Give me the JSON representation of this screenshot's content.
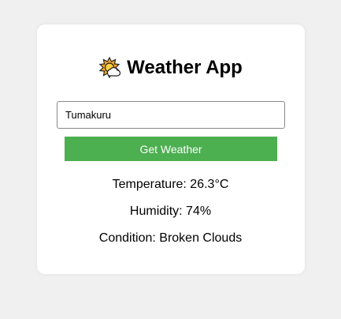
{
  "app": {
    "title": "Weather App",
    "icon": "sun-behind-cloud-icon"
  },
  "search": {
    "value": "Tumakuru",
    "button_label": "Get Weather"
  },
  "weather": {
    "temperature": "Temperature: 26.3°C",
    "humidity": "Humidity: 74%",
    "condition": "Condition: Broken Clouds"
  },
  "colors": {
    "background": "#f0f0f0",
    "card": "#ffffff",
    "button": "#4caf50",
    "button_text": "#ffffff"
  }
}
